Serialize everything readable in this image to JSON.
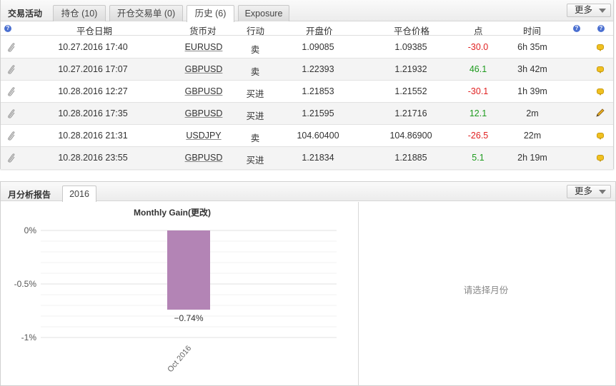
{
  "activity": {
    "title": "交易活动",
    "tabs": [
      {
        "label": "持仓 (10)"
      },
      {
        "label": "开仓交易单 (0)"
      },
      {
        "label": "历史 (6)"
      },
      {
        "label": "Exposure"
      }
    ],
    "active_tab": 2,
    "more_label": "更多",
    "columns": {
      "close_date": "平仓日期",
      "symbol": "货币对",
      "action": "行动",
      "open_price": "开盘价",
      "close_price": "平仓价格",
      "pips": "点",
      "duration": "时间"
    },
    "rows": [
      {
        "close_date": "10.27.2016 17:40",
        "symbol": "EURUSD",
        "action": "卖",
        "open_price": "1.09085",
        "close_price": "1.09385",
        "pips": "-30.0",
        "duration": "6h 35m",
        "note_icon": "comment-icon"
      },
      {
        "close_date": "10.27.2016 17:07",
        "symbol": "GBPUSD",
        "action": "卖",
        "open_price": "1.22393",
        "close_price": "1.21932",
        "pips": "46.1",
        "duration": "3h 42m",
        "note_icon": "comment-icon"
      },
      {
        "close_date": "10.28.2016 12:27",
        "symbol": "GBPUSD",
        "action": "买进",
        "open_price": "1.21853",
        "close_price": "1.21552",
        "pips": "-30.1",
        "duration": "1h 39m",
        "note_icon": "comment-icon"
      },
      {
        "close_date": "10.28.2016 17:35",
        "symbol": "GBPUSD",
        "action": "买进",
        "open_price": "1.21595",
        "close_price": "1.21716",
        "pips": "12.1",
        "duration": "2m",
        "note_icon": "pencil-icon"
      },
      {
        "close_date": "10.28.2016 21:31",
        "symbol": "USDJPY",
        "action": "卖",
        "open_price": "104.60400",
        "close_price": "104.86900",
        "pips": "-26.5",
        "duration": "22m",
        "note_icon": "comment-icon"
      },
      {
        "close_date": "10.28.2016 23:55",
        "symbol": "GBPUSD",
        "action": "买进",
        "open_price": "1.21834",
        "close_price": "1.21885",
        "pips": "5.1",
        "duration": "2h 19m",
        "note_icon": "comment-icon"
      }
    ],
    "colors": {
      "negative": "#e02020",
      "positive": "#1e9b1e"
    }
  },
  "monthly": {
    "title": "月分析报告",
    "tab_label": "2016",
    "more_label": "更多",
    "empty_message": "请选择月份",
    "colors": {
      "bar": "#b384b5"
    }
  },
  "chart_data": {
    "type": "bar",
    "title": "Monthly Gain(更改)",
    "categories": [
      "Oct 2016"
    ],
    "values": [
      -0.74
    ],
    "data_labels": [
      "−0.74%"
    ],
    "y_ticks": [
      "0%",
      "-0.5%",
      "-1%"
    ],
    "y_tick_values": [
      0,
      -0.5,
      -1
    ],
    "ylim": [
      -1,
      0
    ],
    "grid": true,
    "xlabel": "",
    "ylabel": ""
  }
}
